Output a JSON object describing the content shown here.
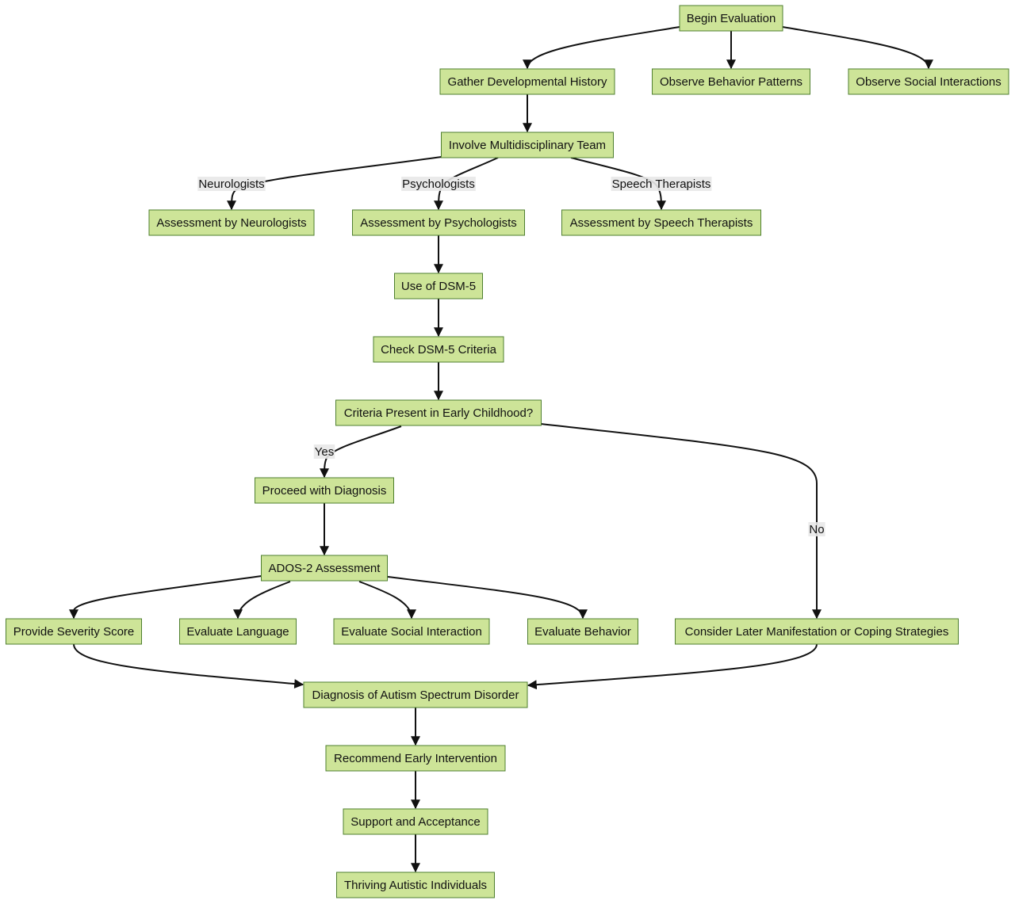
{
  "colors": {
    "node_fill": "#cde498",
    "node_border": "#4f7f2f",
    "edge": "#111111",
    "edge_label_bg": "#e8e8e8"
  },
  "nodes": {
    "begin": "Begin Evaluation",
    "gather": "Gather Developmental History",
    "observe_behavior": "Observe Behavior Patterns",
    "observe_social": "Observe Social Interactions",
    "involve": "Involve Multidisciplinary Team",
    "neuro": "Assessment by Neurologists",
    "psych": "Assessment by Psychologists",
    "speech": "Assessment by Speech Therapists",
    "dsm": "Use of DSM-5",
    "check": "Check DSM-5 Criteria",
    "criteria": "Criteria Present in Early Childhood?",
    "proceed": "Proceed with Diagnosis",
    "ados": "ADOS-2 Assessment",
    "severity": "Provide Severity Score",
    "language": "Evaluate Language",
    "social": "Evaluate Social Interaction",
    "behavior": "Evaluate Behavior",
    "later": "Consider Later Manifestation or Coping Strategies",
    "diagnosis": "Diagnosis of Autism Spectrum Disorder",
    "recommend": "Recommend Early Intervention",
    "support": "Support and Acceptance",
    "thriving": "Thriving Autistic Individuals"
  },
  "edge_labels": {
    "neuro": "Neurologists",
    "psych": "Psychologists",
    "speech": "Speech Therapists",
    "yes": "Yes",
    "no": "No"
  }
}
